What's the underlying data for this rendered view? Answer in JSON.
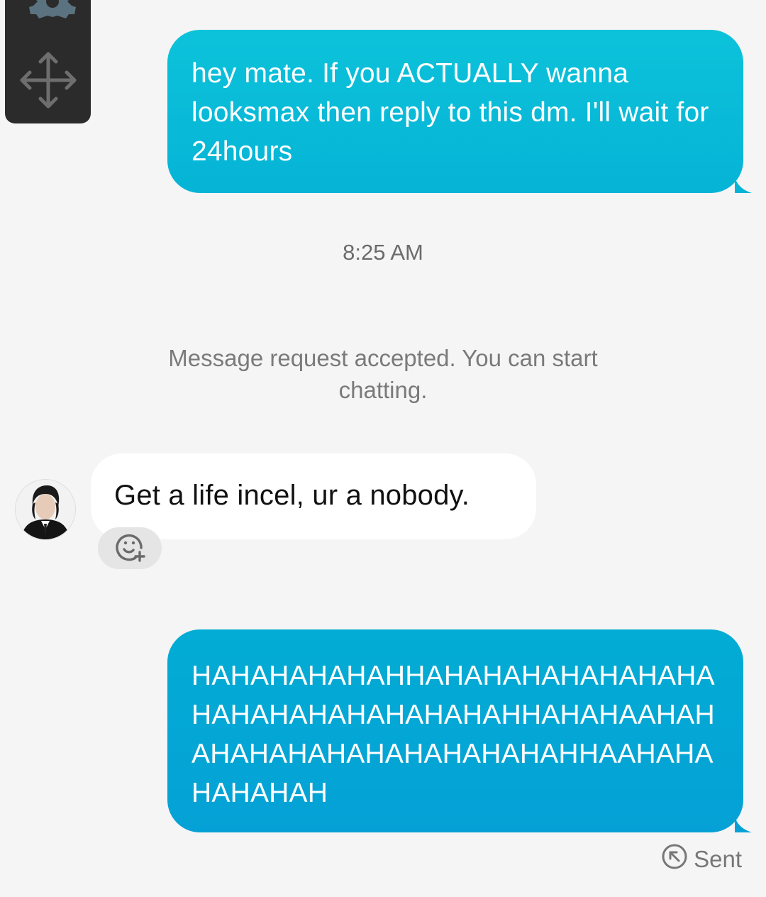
{
  "toolbar": {
    "icons": [
      "gear-icon",
      "move-icon"
    ]
  },
  "thread": {
    "outgoing_1": "hey mate. If you ACTUALLY wanna looksmax then reply to this dm. I'll wait for 24hours",
    "timestamp": "8:25 AM",
    "system_note": "Message request accepted. You can start chatting.",
    "incoming_1": "Get a life incel, ur a nobody.",
    "outgoing_2": "HAHAHAHAHAHHAHAHAHAHAHAHAHAHAHAHAHAHAHAHAHAHHAHAHAAHAHAHAHAHAHAHAHAHAHAHAHHAAHAHAHAHAHAH",
    "status": "Sent"
  },
  "colors": {
    "outgoing_bubble_1": "#0bbfd9",
    "outgoing_bubble_2": "#03a8d5",
    "incoming_bubble": "#ffffff",
    "background": "#f5f5f5"
  }
}
